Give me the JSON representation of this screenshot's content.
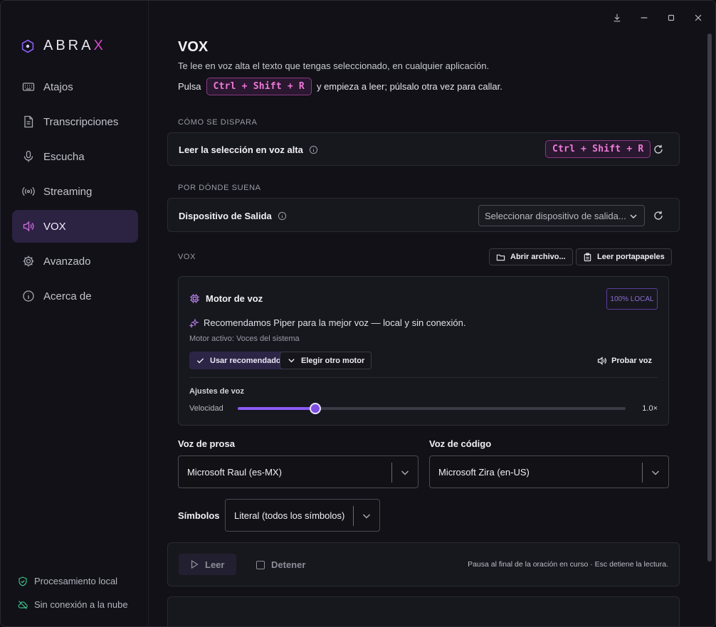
{
  "app": {
    "brand_prefix": "ABRA",
    "brand_accent": "X",
    "accent_color": "#d946c8"
  },
  "sidebar": {
    "items": [
      {
        "label": "Atajos",
        "icon": "keyboard-icon"
      },
      {
        "label": "Transcripciones",
        "icon": "document-icon"
      },
      {
        "label": "Escucha",
        "icon": "microphone-icon"
      },
      {
        "label": "Streaming",
        "icon": "broadcast-icon"
      },
      {
        "label": "VOX",
        "icon": "speaker-icon",
        "active": true
      },
      {
        "label": "Avanzado",
        "icon": "gear-icon"
      },
      {
        "label": "Acerca de",
        "icon": "info-icon"
      }
    ],
    "footer": [
      {
        "label": "Procesamiento local",
        "icon": "shield-check-icon"
      },
      {
        "label": "Sin conexión a la nube",
        "icon": "cloud-off-icon"
      }
    ]
  },
  "page": {
    "title": "VOX",
    "description": "Te lee en voz alta el texto que tengas seleccionado, en cualquier aplicación.",
    "hotkey_prefix": "Pulsa",
    "hotkey": "Ctrl + Shift + R",
    "hotkey_suffix": "y empieza a leer; púlsalo otra vez para callar."
  },
  "trigger": {
    "section": "CÓMO SE DISPARA",
    "label": "Leer la selección en voz alta",
    "hotkey": "Ctrl + Shift + R"
  },
  "output": {
    "section": "POR DÓNDE SUENA",
    "label": "Dispositivo de Salida",
    "placeholder": "Seleccionar dispositivo de salida..."
  },
  "vox": {
    "section": "VOX",
    "open_file": "Abrir archivo...",
    "read_clipboard": "Leer portapapeles"
  },
  "engine": {
    "title": "Motor de voz",
    "badge": "100% LOCAL",
    "recommendation": "Recomendamos Piper para la mejor voz — local y sin conexión.",
    "active": "Motor activo: Voces del sistema",
    "use_recommended": "Usar recomendado",
    "choose_other": "Elegir otro motor",
    "test_voice": "Probar voz",
    "settings_title": "Ajustes de voz",
    "speed_label": "Velocidad",
    "speed_value": "1.0×",
    "speed_fraction": 0.2
  },
  "voices": {
    "prose_label": "Voz de prosa",
    "prose_value": "Microsoft Raul (es-MX)",
    "code_label": "Voz de código",
    "code_value": "Microsoft Zira (en-US)",
    "symbols_label": "Símbolos",
    "symbols_value": "Literal (todos los símbolos)"
  },
  "reader": {
    "read": "Leer",
    "stop": "Detener",
    "hint": "Pausa al final de la oración en curso · Esc detiene la lectura."
  }
}
